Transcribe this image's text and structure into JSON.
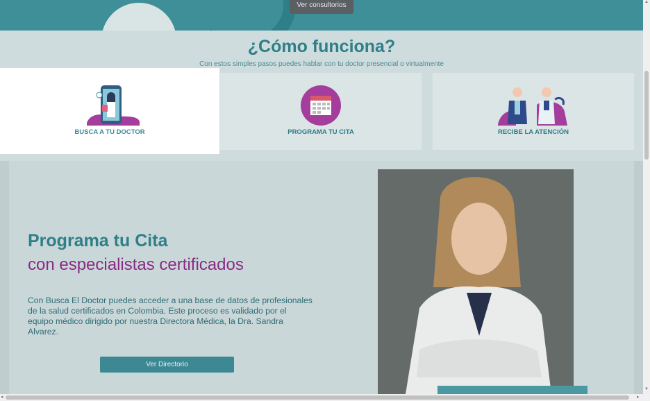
{
  "hero": {
    "button_label": "Ver consultorios"
  },
  "how": {
    "title": "¿Cómo funciona?",
    "subtitle": "Con estos simples pasos puedes hablar con tu doctor presencial o virtualmente",
    "cards": [
      {
        "label": "BUSCA A TU DOCTOR",
        "icon": "phone-doctor-icon"
      },
      {
        "label": "PROGRAMA TU CITA",
        "icon": "calendar-icon"
      },
      {
        "label": "RECIBE LA ATENCIÓN",
        "icon": "doctors-team-icon"
      }
    ]
  },
  "section": {
    "title_line1": "Programa tu Cita",
    "title_line2": "con especialistas certificados",
    "paragraph": "Con Busca El Doctor puedes acceder a una base de datos de profesionales de la salud certificados en Colombia. Este proceso es validado por el equipo médico dirigido por nuestra Directora Médica, la Dra. Sandra Alvarez.",
    "button_label": "Ver Directorio"
  },
  "colors": {
    "teal": "#2e7f88",
    "magenta": "#8a2a86"
  }
}
